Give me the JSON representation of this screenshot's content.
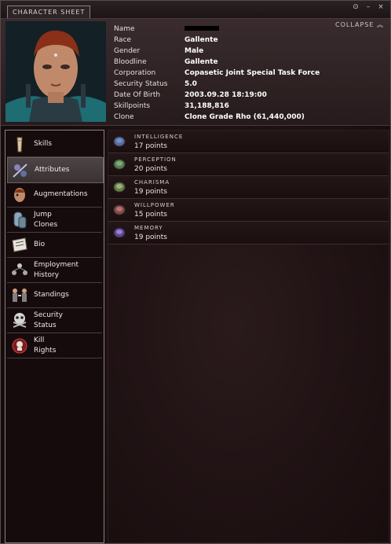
{
  "window": {
    "tab_label": "CHARACTER SHEET",
    "collapse_label": "COLLAPSE",
    "buttons": [
      "gear-icon",
      "minimize-icon",
      "close-icon"
    ]
  },
  "character": {
    "fields": [
      {
        "label": "Name",
        "value": ""
      },
      {
        "label": "Race",
        "value": "Gallente"
      },
      {
        "label": "Gender",
        "value": "Male"
      },
      {
        "label": "Bloodline",
        "value": "Gallente"
      },
      {
        "label": "Corporation",
        "value": "Copasetic Joint Special Task Force"
      },
      {
        "label": "Security Status",
        "value": "5.0"
      },
      {
        "label": "Date Of Birth",
        "value": "2003.09.28 18:19:00"
      },
      {
        "label": "Skillpoints",
        "value": "31,188,816"
      },
      {
        "label": "Clone",
        "value": "Clone Grade Rho (61,440,000)"
      }
    ]
  },
  "sidebar": {
    "items": [
      {
        "label": "Skills",
        "icon": "skills-icon",
        "active": false
      },
      {
        "label": "Attributes",
        "icon": "attributes-icon",
        "active": true
      },
      {
        "label": "Augmentations",
        "icon": "augmentations-icon",
        "active": false
      },
      {
        "label": "Jump\nClones",
        "icon": "jump-clones-icon",
        "active": false
      },
      {
        "label": "Bio",
        "icon": "bio-icon",
        "active": false
      },
      {
        "label": "Employment\nHistory",
        "icon": "employment-history-icon",
        "active": false
      },
      {
        "label": "Standings",
        "icon": "standings-icon",
        "active": false
      },
      {
        "label": "Security\nStatus",
        "icon": "security-status-icon",
        "active": false
      },
      {
        "label": "Kill\nRights",
        "icon": "kill-rights-icon",
        "active": false
      }
    ]
  },
  "attributes": [
    {
      "name": "INTELLIGENCE",
      "points": "17 points",
      "color": "#6f8fcf"
    },
    {
      "name": "PERCEPTION",
      "points": "20 points",
      "color": "#7fae6f"
    },
    {
      "name": "CHARISMA",
      "points": "19 points",
      "color": "#9fb07a"
    },
    {
      "name": "WILLPOWER",
      "points": "15 points",
      "color": "#c0706a"
    },
    {
      "name": "MEMORY",
      "points": "19 points",
      "color": "#9f7ad0"
    }
  ]
}
